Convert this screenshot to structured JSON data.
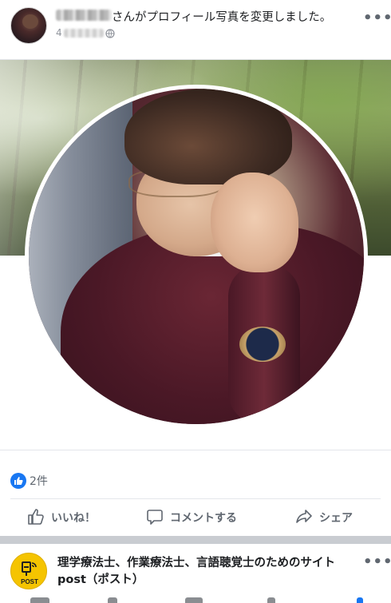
{
  "post": {
    "header_text": "さんがプロフィール写真を変更しました。",
    "meta_num": "4",
    "more_label": "•••",
    "reactions": {
      "count": "2件"
    },
    "actions": {
      "like": "いいね！",
      "comment": "コメントする",
      "share": "シェア"
    }
  },
  "next_post": {
    "page_name_line1": "理学療法士、作業療法士、言語聴覚士のためのサイト",
    "page_name_line2": "post（ポスト）",
    "logo_text": "POST",
    "more_label": "•••"
  },
  "colors": {
    "accent": "#1877f2",
    "logo_yellow": "#f5c400",
    "muted_text": "#606770"
  }
}
